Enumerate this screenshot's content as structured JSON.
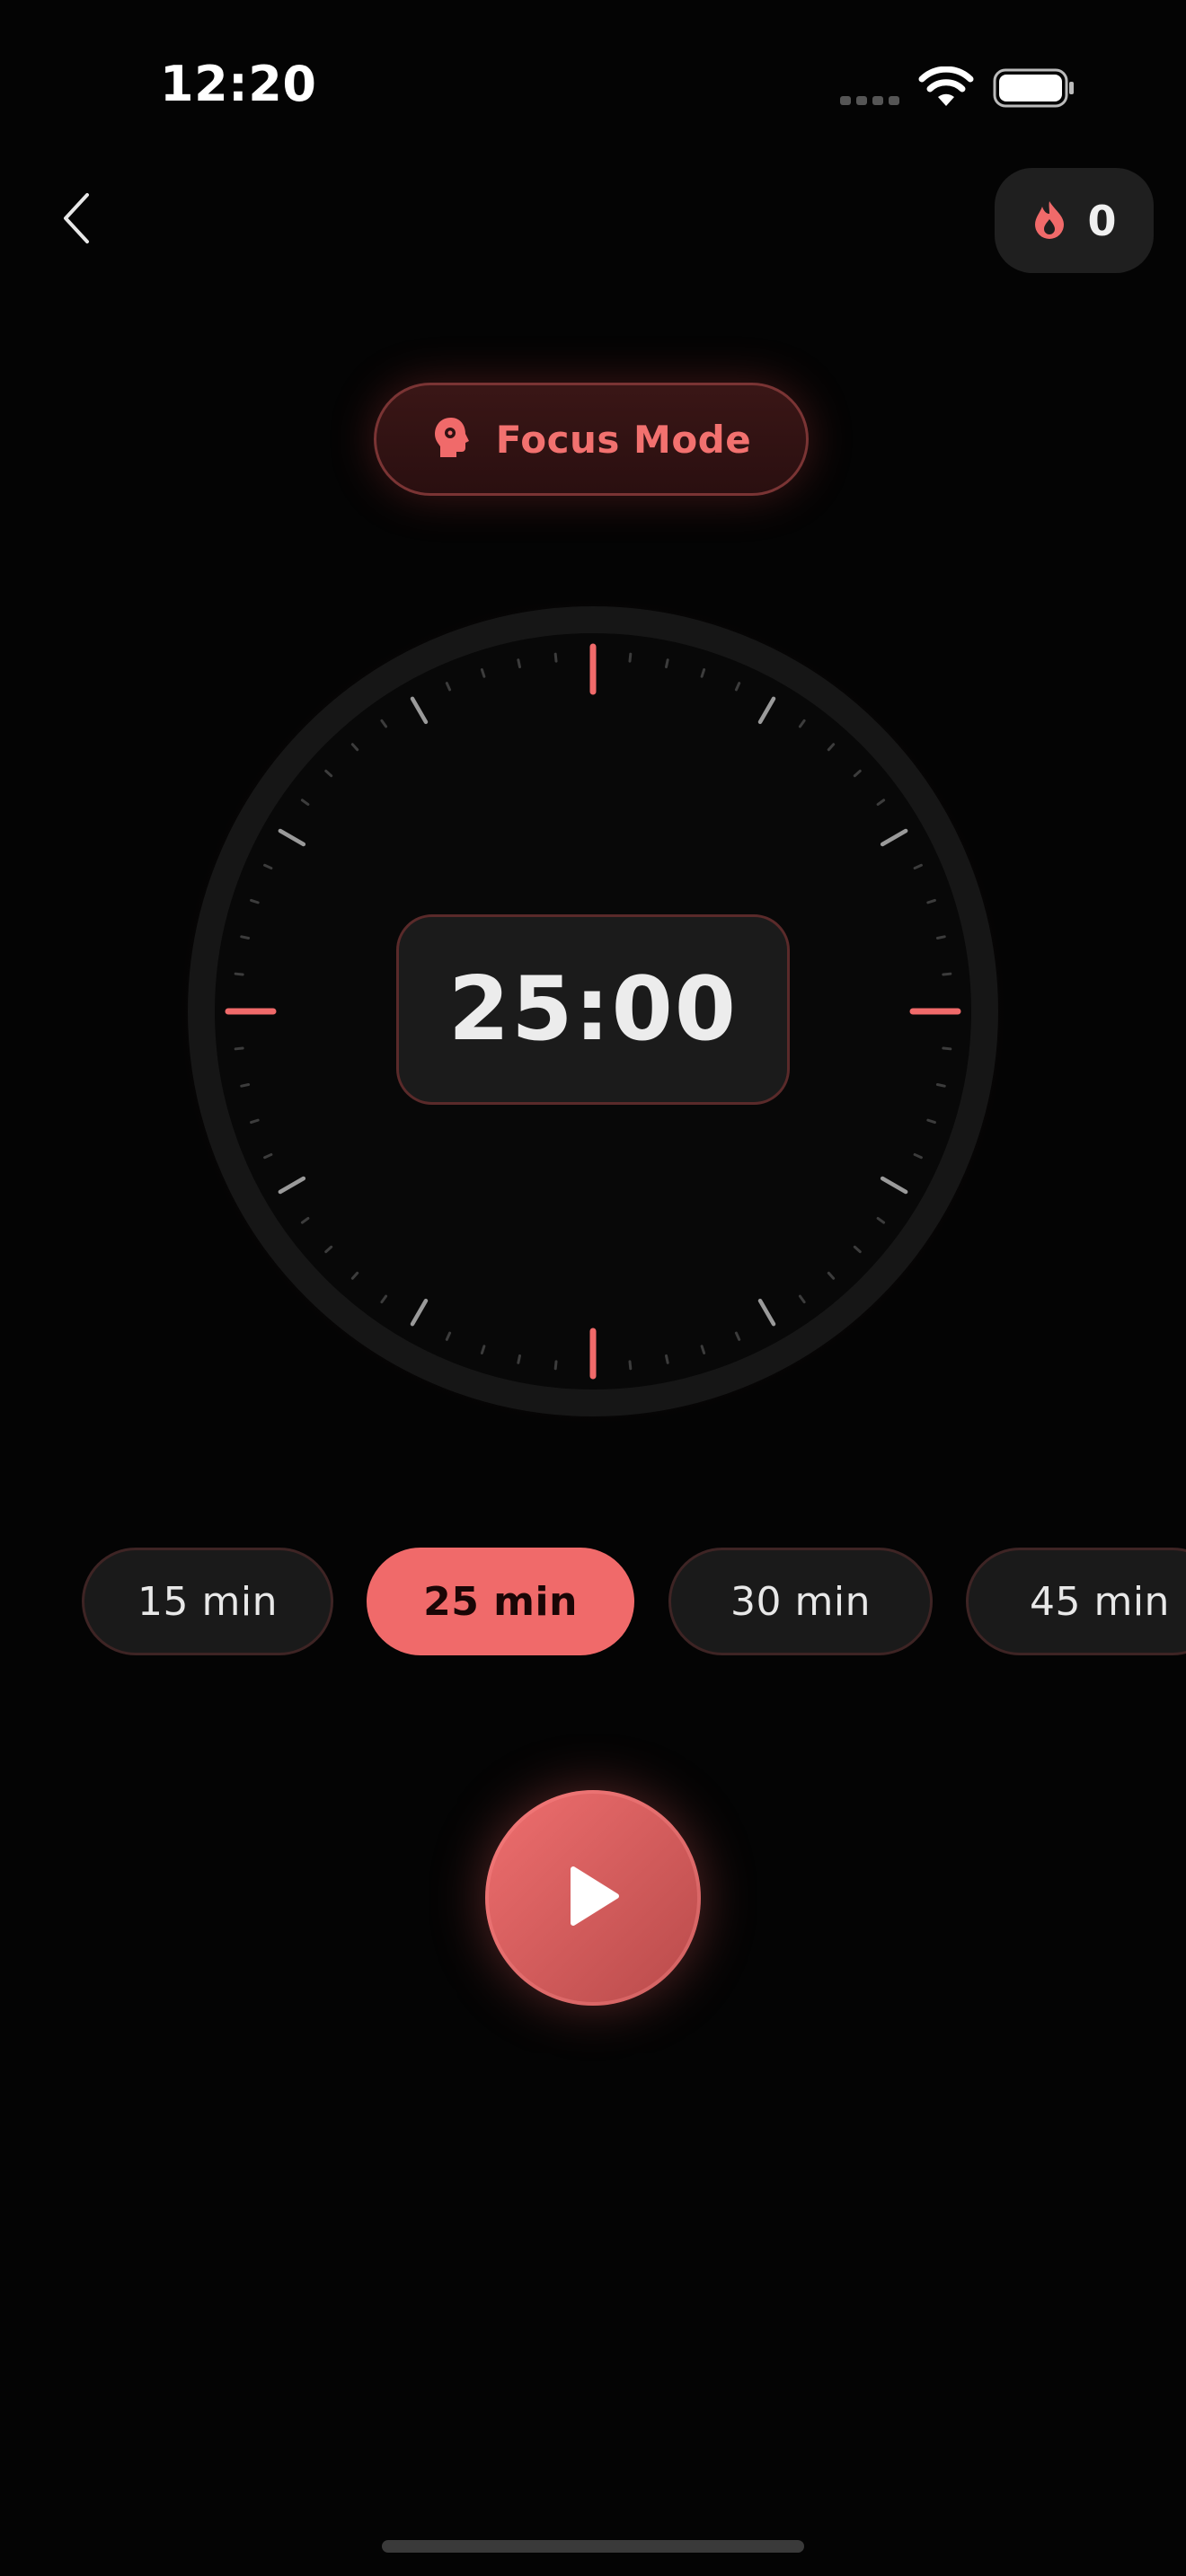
{
  "status_bar": {
    "time": "12:20"
  },
  "header": {
    "streak_count": "0"
  },
  "focus_mode": {
    "label": "Focus Mode"
  },
  "timer": {
    "display": "25:00"
  },
  "durations": [
    {
      "label": "15 min",
      "selected": false
    },
    {
      "label": "25 min",
      "selected": true
    },
    {
      "label": "30 min",
      "selected": false
    },
    {
      "label": "45 min",
      "selected": false
    }
  ],
  "icons": {
    "back": "chevron-left-icon",
    "streak": "flame-icon",
    "focus": "brain-head-icon",
    "play": "play-icon"
  },
  "colors": {
    "accent": "#f06a6a",
    "background": "#040404",
    "surface": "#1b1b1b",
    "text": "#ececec"
  }
}
